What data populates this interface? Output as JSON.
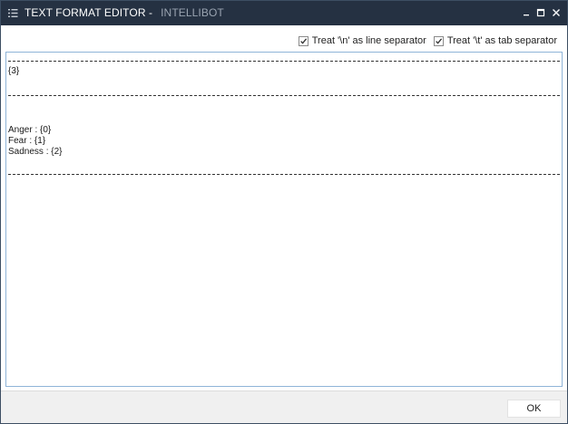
{
  "window": {
    "title": "TEXT FORMAT EDITOR -",
    "subtitle": "INTELLIBOT",
    "titlebar_color": "#253142"
  },
  "window_controls": {
    "minimize_icon": "minimize-icon",
    "maximize_icon": "maximize-icon",
    "close_icon": "close-icon"
  },
  "options": {
    "newline": {
      "label": "Treat '\\n' as line separator",
      "checked": true
    },
    "tab": {
      "label": "Treat '\\t' as tab separator",
      "checked": true
    }
  },
  "editor": {
    "header_placeholder": "{3}",
    "lines": [
      "Anger : {0}",
      "Fear : {1}",
      "Sadness : {2}"
    ]
  },
  "footer": {
    "ok_label": "OK"
  }
}
